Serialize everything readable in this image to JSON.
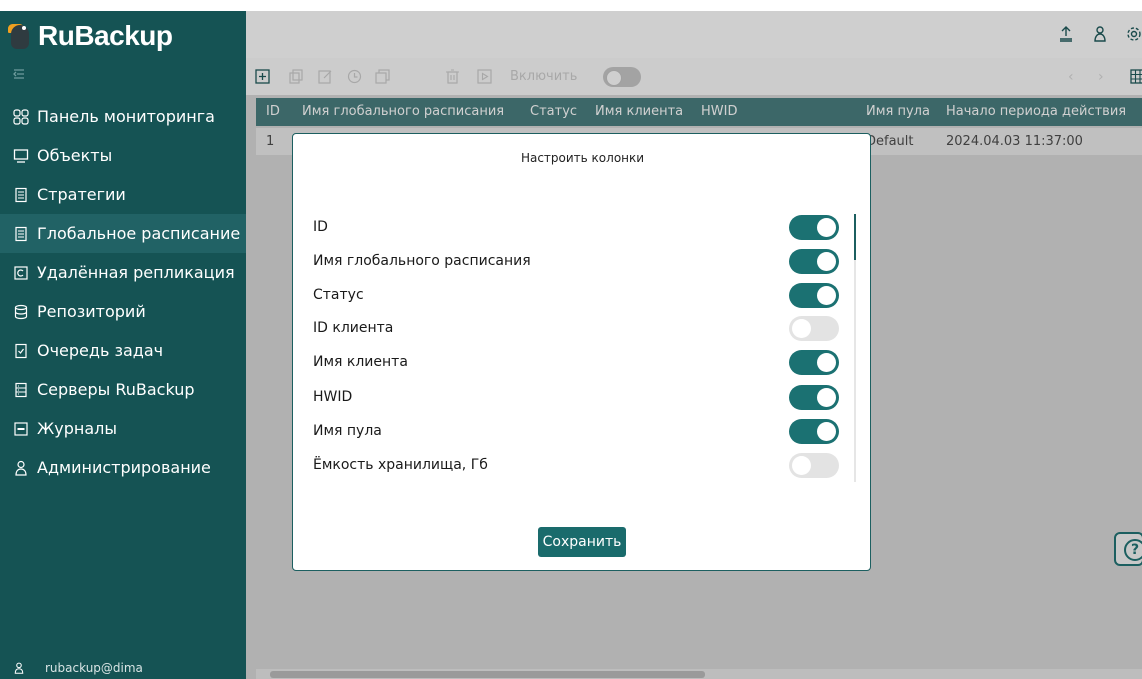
{
  "app": {
    "logo_text": "RuBackup"
  },
  "sidebar": {
    "items": [
      {
        "label": "Панель мониторинга",
        "icon": "dashboard-icon"
      },
      {
        "label": "Объекты",
        "icon": "monitor-icon"
      },
      {
        "label": "Стратегии",
        "icon": "document-icon"
      },
      {
        "label": "Глобальное расписание",
        "icon": "schedule-icon",
        "active": true
      },
      {
        "label": "Удалённая репликация",
        "icon": "replication-icon"
      },
      {
        "label": "Репозиторий",
        "icon": "database-icon"
      },
      {
        "label": "Очередь задач",
        "icon": "task-queue-icon"
      },
      {
        "label": "Серверы RuBackup",
        "icon": "server-icon"
      },
      {
        "label": "Журналы",
        "icon": "log-icon"
      },
      {
        "label": "Администрирование",
        "icon": "admin-user-icon"
      }
    ],
    "user": "rubackup@dima"
  },
  "toolbar": {
    "enable_label": "Включить"
  },
  "table": {
    "headers": [
      "ID",
      "Имя глобального расписания",
      "Статус",
      "Имя клиента",
      "HWID",
      "Имя пула",
      "Начало периода действия"
    ],
    "rows": [
      {
        "id": "1",
        "pool": "Default",
        "start": "2024.04.03 11:37:00"
      }
    ]
  },
  "dialog": {
    "title": "Настроить колонки",
    "columns": [
      {
        "label": "ID",
        "enabled": true
      },
      {
        "label": "Имя глобального расписания",
        "enabled": true
      },
      {
        "label": "Статус",
        "enabled": true
      },
      {
        "label": "ID клиента",
        "enabled": false
      },
      {
        "label": "Имя клиента",
        "enabled": true
      },
      {
        "label": "HWID",
        "enabled": true
      },
      {
        "label": "Имя пула",
        "enabled": true
      },
      {
        "label": "Ёмкость хранилища, Гб",
        "enabled": false
      }
    ],
    "save_label": "Сохранить"
  },
  "colors": {
    "sidebar": "#155354",
    "accent": "#1b7172",
    "header": "#1c5f60"
  }
}
